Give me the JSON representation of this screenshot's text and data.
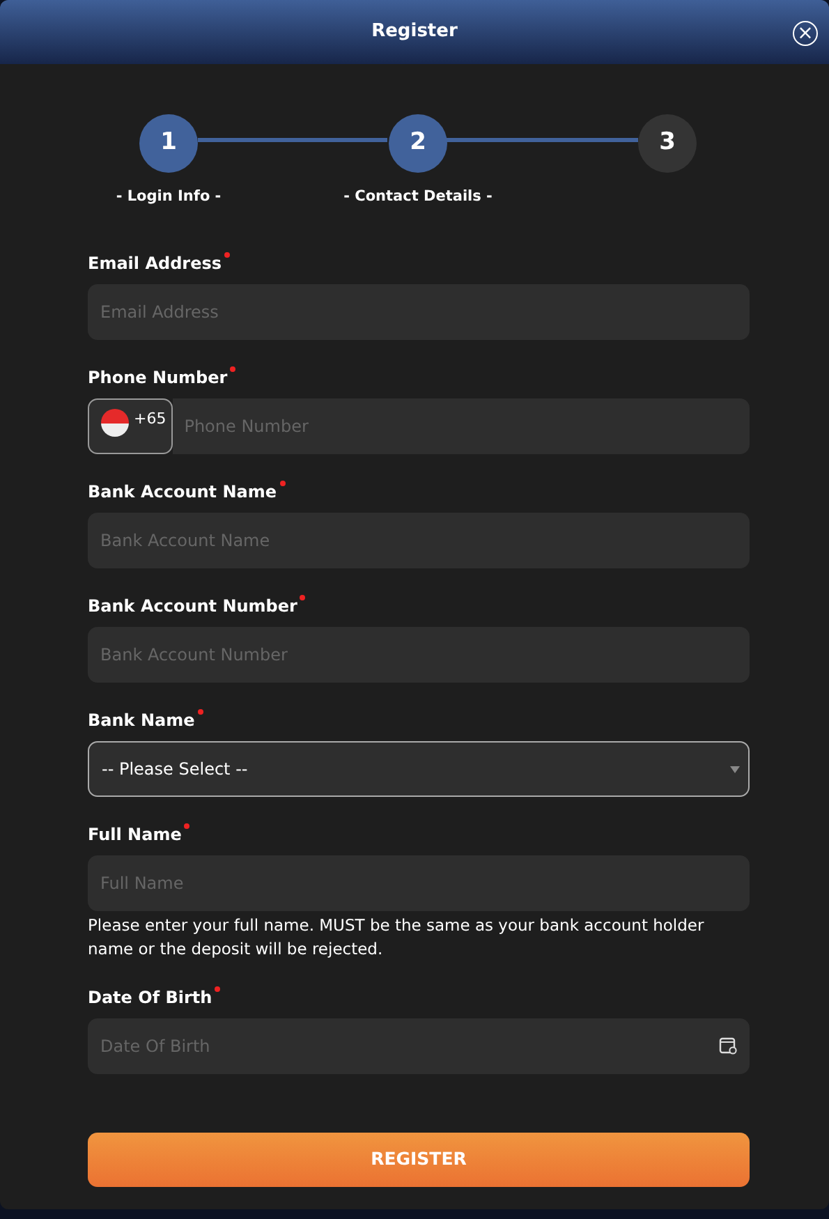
{
  "window": {
    "title": "Register",
    "close": "×"
  },
  "steps": [
    {
      "number": "1",
      "label": "- Login Info -",
      "reached": true
    },
    {
      "number": "2",
      "label": "- Contact Details -",
      "reached": true
    },
    {
      "number": "3",
      "reached": false
    }
  ],
  "fields": [
    {
      "kind": "text",
      "label": "Email Address",
      "required": true,
      "placeholder": "Email Address"
    },
    {
      "kind": "phone",
      "label": "Phone Number",
      "required": true,
      "code": "+65",
      "placeholder": "Phone Number"
    },
    {
      "kind": "text",
      "label": "Bank Account Name",
      "required": true,
      "placeholder": "Bank Account Name"
    },
    {
      "kind": "text",
      "label": "Bank Account Number",
      "required": true,
      "placeholder": "Bank Account Number"
    },
    {
      "kind": "select",
      "label": "Bank Name",
      "required": true,
      "value": "-- Please Select --"
    },
    {
      "kind": "text",
      "label": "Full Name",
      "required": true,
      "placeholder": "Full Name",
      "help": "Please enter your full name. MUST be the same as your bank account holder name or the deposit will be rejected."
    },
    {
      "kind": "date",
      "label": "Date Of Birth",
      "required": true,
      "placeholder": "Date Of Birth"
    }
  ],
  "submit": "REGISTER"
}
